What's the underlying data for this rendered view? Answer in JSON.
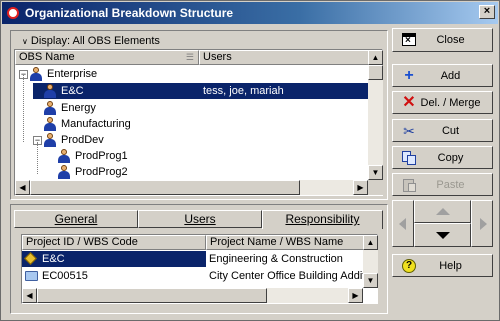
{
  "window": {
    "title": "Organizational Breakdown Structure"
  },
  "obs": {
    "display_label": "Display: All OBS Elements",
    "columns": {
      "name": "OBS Name",
      "users": "Users"
    },
    "rows": [
      {
        "name": "Enterprise",
        "users": ""
      },
      {
        "name": "E&C",
        "users": "tess, joe, mariah"
      },
      {
        "name": "Energy",
        "users": ""
      },
      {
        "name": "Manufacturing",
        "users": ""
      },
      {
        "name": "ProdDev",
        "users": ""
      },
      {
        "name": "ProdProg1",
        "users": ""
      },
      {
        "name": "ProdProg2",
        "users": ""
      }
    ]
  },
  "tabs": {
    "general": "General",
    "users": "Users",
    "responsibility": "Responsibility"
  },
  "resp": {
    "columns": {
      "id": "Project ID / WBS Code",
      "name": "Project Name / WBS Name"
    },
    "rows": [
      {
        "id": "E&C",
        "name": "Engineering & Construction"
      },
      {
        "id": "EC00515",
        "name": "City Center Office Building Addition"
      }
    ]
  },
  "buttons": {
    "close": "Close",
    "add": "Add",
    "delete_merge": "Del. / Merge",
    "cut": "Cut",
    "copy": "Copy",
    "paste": "Paste",
    "help": "Help"
  },
  "colors": {
    "selection": "#0a246a",
    "title_start": "#0a246a",
    "title_end": "#a6caf0"
  }
}
